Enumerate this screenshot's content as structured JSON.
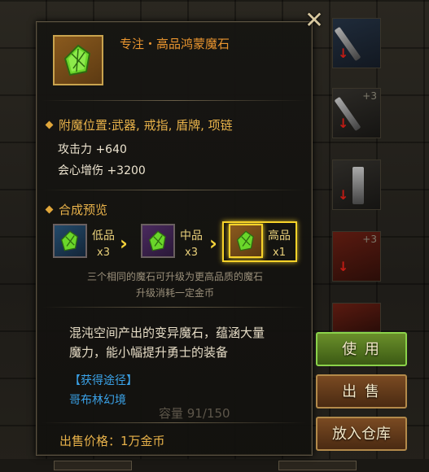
{
  "item": {
    "name": "专注・高品鸿蒙魔石"
  },
  "enchant": {
    "heading": "附魔位置:武器, 戒指, 盾牌, 项链",
    "stats": [
      {
        "label": "攻击力 +640"
      },
      {
        "label": "会心增伤 +3200"
      }
    ]
  },
  "synthesis": {
    "heading": "合成预览",
    "tiers": [
      {
        "label": "低品",
        "qty": "x3"
      },
      {
        "label": "中品",
        "qty": "x3"
      },
      {
        "label": "高品",
        "qty": "x1"
      }
    ],
    "note_line1": "三个相同的魔石可升级为更高品质的魔石",
    "note_line2": "升级消耗一定金币"
  },
  "description": {
    "line1": "混沌空间产出的变异魔石，蕴涵大量",
    "line2": "魔力，能小幅提升勇士的装备"
  },
  "source": {
    "heading": "【获得途径】",
    "location": "哥布林幻境"
  },
  "capacity": "容量  91/150",
  "price": "出售价格：1万金币",
  "buttons": {
    "use": "使 用",
    "sell": "出 售",
    "store": "放入仓库"
  },
  "inventory_badges": {
    "plus3": "+3"
  },
  "colors": {
    "accent_gold": "#e8b24a",
    "item_name_orange": "#e9952f",
    "link_blue": "#3aa2e8",
    "highlight_yellow": "#f7d32a",
    "gem_green": "#6ad62a"
  }
}
